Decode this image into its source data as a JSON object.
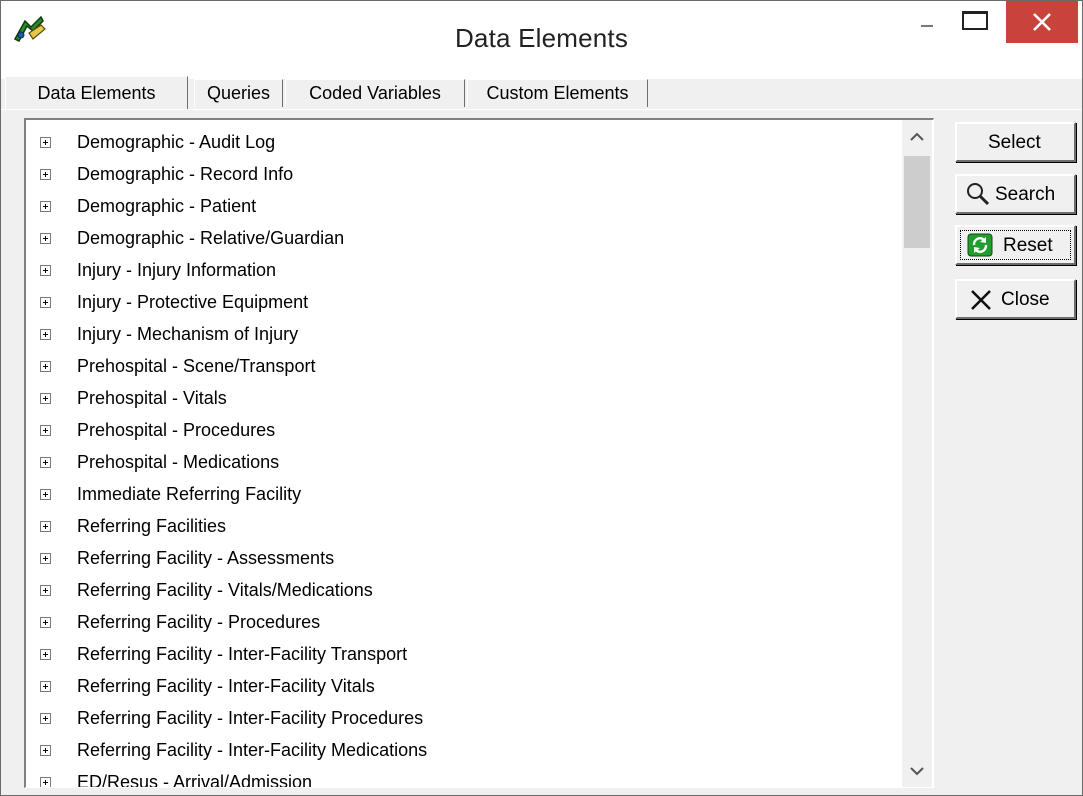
{
  "window": {
    "title": "Data Elements"
  },
  "tabs": [
    {
      "label": "Data Elements",
      "active": true
    },
    {
      "label": "Queries",
      "active": false
    },
    {
      "label": "Coded Variables",
      "active": false
    },
    {
      "label": "Custom Elements",
      "active": false
    }
  ],
  "tree": {
    "items": [
      "Demographic - Audit Log",
      "Demographic - Record Info",
      "Demographic - Patient",
      "Demographic - Relative/Guardian",
      "Injury - Injury Information",
      "Injury - Protective Equipment",
      "Injury - Mechanism of Injury",
      "Prehospital - Scene/Transport",
      "Prehospital - Vitals",
      "Prehospital - Procedures",
      "Prehospital - Medications",
      "Immediate Referring Facility",
      "Referring Facilities",
      "Referring Facility - Assessments",
      "Referring Facility - Vitals/Medications",
      "Referring Facility - Procedures",
      "Referring Facility - Inter-Facility Transport",
      "Referring Facility - Inter-Facility Vitals",
      "Referring Facility - Inter-Facility Procedures",
      "Referring Facility - Inter-Facility Medications",
      "ED/Resus - Arrival/Admission"
    ]
  },
  "buttons": {
    "select": "Select",
    "search": "Search",
    "reset": "Reset",
    "close": "Close"
  },
  "colors": {
    "close_button_bg": "#c7433b",
    "window_bg": "#f0f0f0",
    "reset_icon": "#1f9e2e"
  }
}
